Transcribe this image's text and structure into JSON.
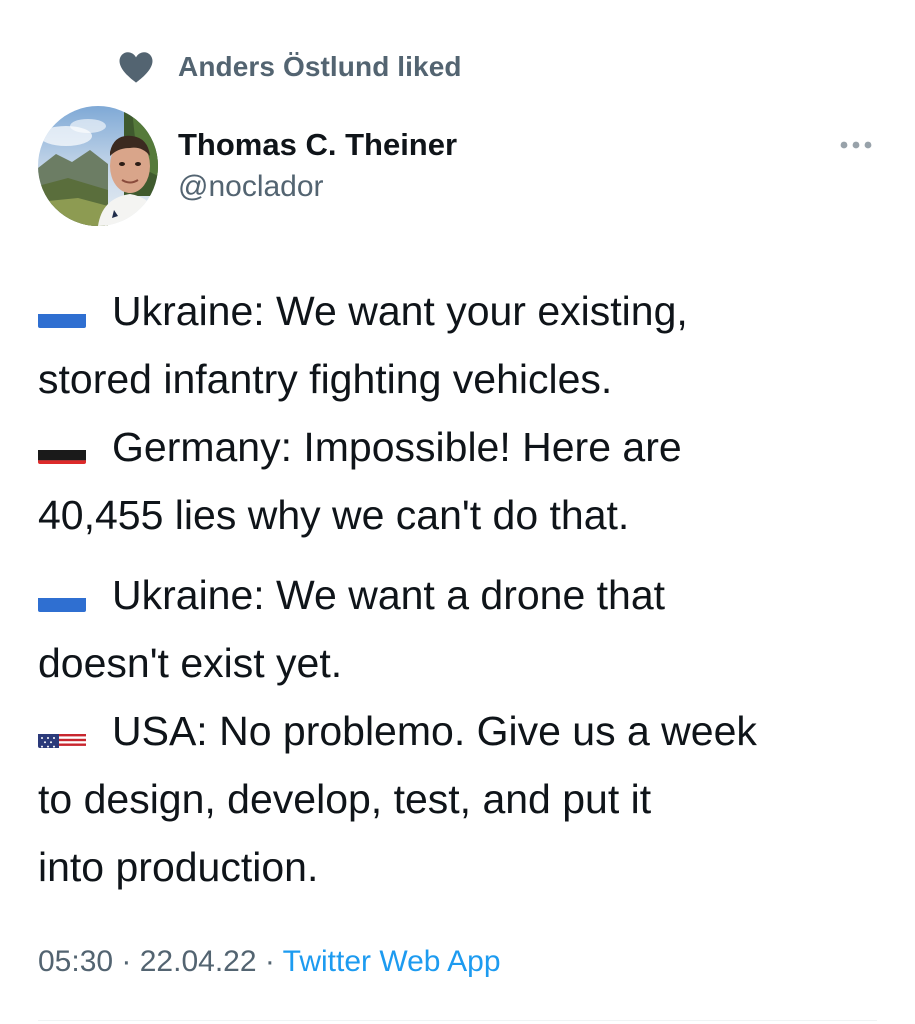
{
  "social_context": {
    "text": "Anders Östlund liked",
    "icon": "heart-icon"
  },
  "author": {
    "name": "Thomas C. Theiner",
    "handle": "@noclador"
  },
  "tweet": {
    "paragraphs": [
      {
        "flag": "ukraine-flag-icon",
        "line1": "Ukraine: We want your existing,",
        "line2": "stored infantry fighting vehicles."
      },
      {
        "flag": "germany-flag-icon",
        "line1": "Germany: Impossible! Here are",
        "line2": "40,455 lies why we can't do that."
      },
      {
        "flag": "ukraine-flag-icon",
        "line1": "Ukraine: We want a drone that",
        "line2": "doesn't exist yet."
      },
      {
        "flag": "usa-flag-icon",
        "line1": "USA: No problemo. Give us a week",
        "line2": "to design, develop, test, and put it",
        "line3": "into production."
      }
    ]
  },
  "meta": {
    "time": "05:30",
    "separator": " · ",
    "date": "22.04.22",
    "source": "Twitter Web App"
  },
  "colors": {
    "secondary_text": "#536471",
    "link": "#1d9bf0",
    "primary_text": "#0f1419"
  }
}
